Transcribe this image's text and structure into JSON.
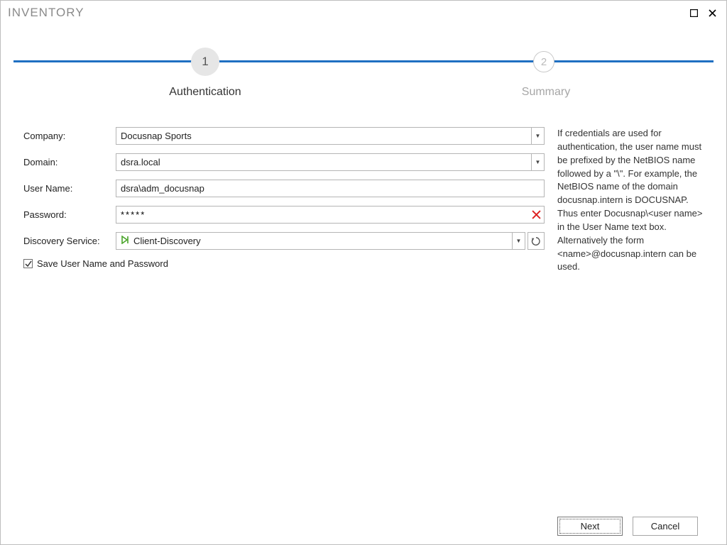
{
  "title": "INVENTORY",
  "stepper": {
    "steps": [
      {
        "num": "1",
        "label": "Authentication"
      },
      {
        "num": "2",
        "label": "Summary"
      }
    ]
  },
  "form": {
    "company_label": "Company:",
    "company_value": "Docusnap Sports",
    "domain_label": "Domain:",
    "domain_value": "dsra.local",
    "username_label": "User Name:",
    "username_value": "dsra\\adm_docusnap",
    "password_label": "Password:",
    "password_value": "*****",
    "discovery_label": "Discovery Service:",
    "discovery_value": "Client-Discovery",
    "save_creds_label": "Save User Name and Password",
    "save_creds_checked": true
  },
  "help_text": "If credentials are used for authentication, the user name must be prefixed by the NetBIOS name followed by a \"\\\". For example, the NetBIOS name of the domain docusnap.intern is DOCUSNAP. Thus enter Docusnap\\<user name> in the User Name text box. Alternatively the form <name>@docusnap.intern can be used.",
  "footer": {
    "next_label": "Next",
    "cancel_label": "Cancel"
  },
  "icons": {
    "dropdown": "▾",
    "check": "✓",
    "maximize": "□",
    "close": "✕"
  }
}
